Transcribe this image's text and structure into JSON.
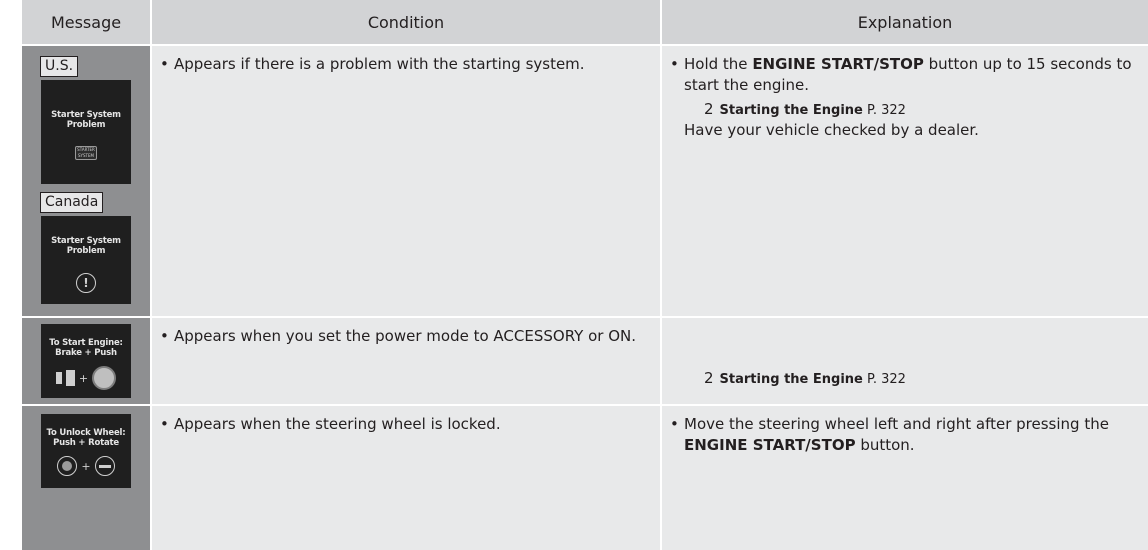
{
  "table": {
    "headers": {
      "message": "Message",
      "condition": "Condition",
      "explanation": "Explanation"
    },
    "rows": [
      {
        "regions": [
          "U.S.",
          "Canada"
        ],
        "screens": [
          {
            "lines": [
              "Starter System",
              "Problem"
            ],
            "icon": "starter-system-icon",
            "icon_text": "STARTER SYSTEM"
          },
          {
            "lines": [
              "Starter System",
              "Problem"
            ],
            "icon": "warning-exclamation-icon"
          }
        ],
        "condition": "Appears if there is a problem with the starting system.",
        "explanation": {
          "pre": "Hold the ",
          "bold": "ENGINE START/STOP",
          "post": " button up to 15 seconds to start the engine.",
          "ref_title": "Starting the Engine",
          "ref_page": "P. 322",
          "extra": "Have your vehicle checked by a dealer."
        }
      },
      {
        "screens": [
          {
            "lines": [
              "To Start Engine:",
              "Brake + Push"
            ],
            "icons": [
              "brake-pedal-icon",
              "plus-icon",
              "engine-start-button-icon"
            ]
          }
        ],
        "condition": "Appears when you set the power mode to ACCESSORY or ON.",
        "explanation": {
          "ref_title": "Starting the Engine",
          "ref_page": "P. 322"
        }
      },
      {
        "screens": [
          {
            "lines": [
              "To Unlock Wheel:",
              "Push + Rotate"
            ],
            "icons": [
              "engine-start-button-icon",
              "plus-icon",
              "steering-wheel-icon"
            ]
          }
        ],
        "condition": "Appears when the steering wheel is locked.",
        "explanation": {
          "pre": "Move the steering wheel left and right after pressing the ",
          "bold": "ENGINE START/STOP",
          "post": " button."
        }
      }
    ],
    "bullet": "•",
    "ref_arrow": "2",
    "plus": "+",
    "warn": "!"
  }
}
